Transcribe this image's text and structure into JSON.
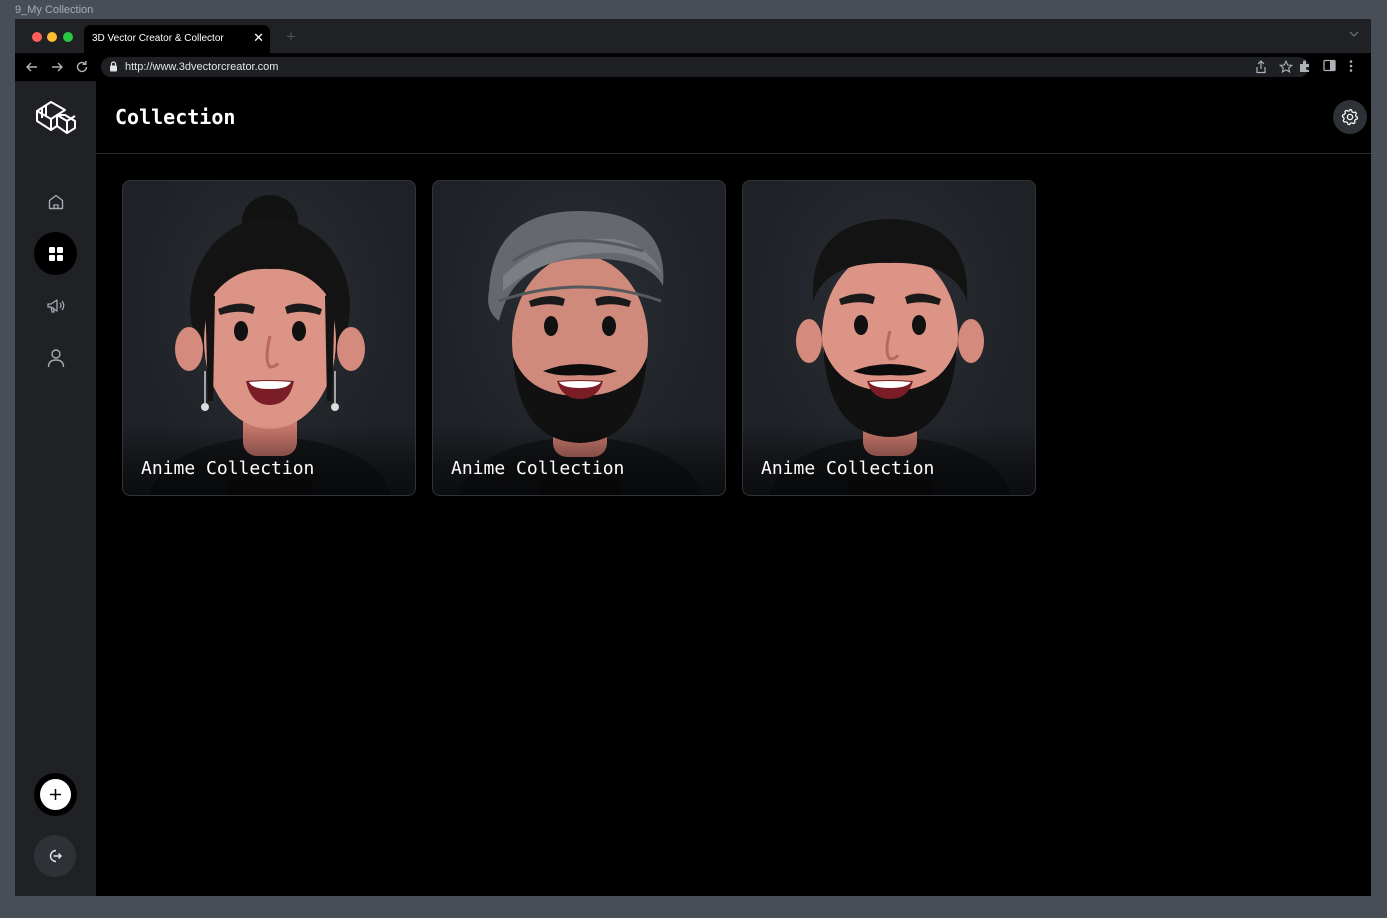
{
  "frame_label": "9_My Collection",
  "browser": {
    "tab_title": "3D Vector Creator & Collector",
    "tab_close": "✕",
    "new_tab": "+",
    "url": "http://www.3dvectorcreator.com"
  },
  "sidebar": {
    "items": [
      {
        "name": "home",
        "icon": "home-icon",
        "active": false
      },
      {
        "name": "collection",
        "icon": "grid-icon",
        "active": true
      },
      {
        "name": "announcements",
        "icon": "megaphone-icon",
        "active": false
      },
      {
        "name": "profile",
        "icon": "user-icon",
        "active": false
      }
    ],
    "add_icon": "plus-icon",
    "logout_icon": "logout-icon"
  },
  "header": {
    "title": "Collection",
    "settings_icon": "gear-icon"
  },
  "collections": [
    {
      "label": "Anime Collection",
      "avatar": "woman-with-bun-and-earrings"
    },
    {
      "label": "Anime Collection",
      "avatar": "man-with-turban-and-beard"
    },
    {
      "label": "Anime Collection",
      "avatar": "man-with-short-hair-and-beard"
    }
  ],
  "colors": {
    "background": "#000000",
    "sidebar": "#1f2125",
    "card": "#1e2126",
    "skin": "#d98c7e",
    "hair": "#111111",
    "turban": "#6b6e72"
  }
}
